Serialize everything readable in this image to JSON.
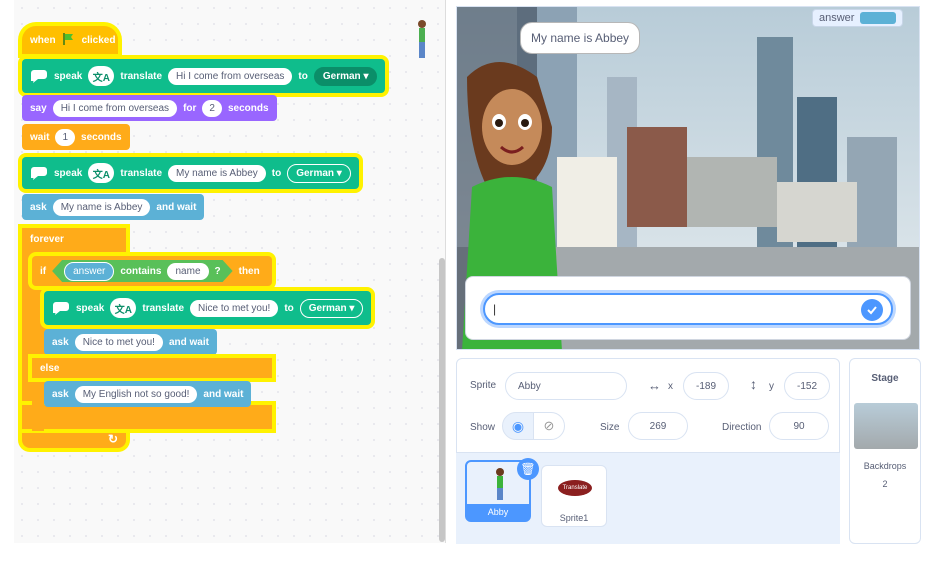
{
  "blocks": {
    "when": "when",
    "clicked": "clicked",
    "speak": "speak",
    "translate": "translate",
    "to": "to",
    "say": "say",
    "for": "for",
    "seconds": "seconds",
    "wait": "wait",
    "ask": "ask",
    "and_wait": "and wait",
    "forever": "forever",
    "if": "if",
    "then": "then",
    "else": "else",
    "contains": "contains",
    "q": "?",
    "text1": "Hi I come from overseas",
    "lang1": "German",
    "say_text": "Hi I come from overseas",
    "say_secs": "2",
    "wait_secs": "1",
    "text2": "My name is Abbey",
    "lang2": "German",
    "ask1": "My name is Abbey",
    "answer": "answer",
    "name": "name",
    "text3": "Nice to met you!",
    "lang3": "German",
    "ask2": "Nice to met you!",
    "ask3": "My English not so good!"
  },
  "stage": {
    "bubble": "My name is Abbey",
    "monitor_label": "answer",
    "ask_value": "|"
  },
  "sprite_info": {
    "sprite_label": "Sprite",
    "sprite_name": "Abby",
    "x_label": "x",
    "x": "-189",
    "y_label": "y",
    "y": "-152",
    "show_label": "Show",
    "size_label": "Size",
    "size": "269",
    "direction_label": "Direction",
    "direction": "90"
  },
  "sprites": [
    {
      "name": "Abby"
    },
    {
      "name": "Sprite1",
      "badge": "Translate"
    }
  ],
  "stage_panel": {
    "title": "Stage",
    "backdrops_label": "Backdrops",
    "backdrops_count": "2"
  },
  "colors": {
    "events": "#ffbf00",
    "control": "#ffab19",
    "looks": "#9966ff",
    "sensing": "#5cb1d6",
    "extension": "#0fbd8c",
    "operators": "#59c059",
    "accent": "#4c97ff"
  }
}
